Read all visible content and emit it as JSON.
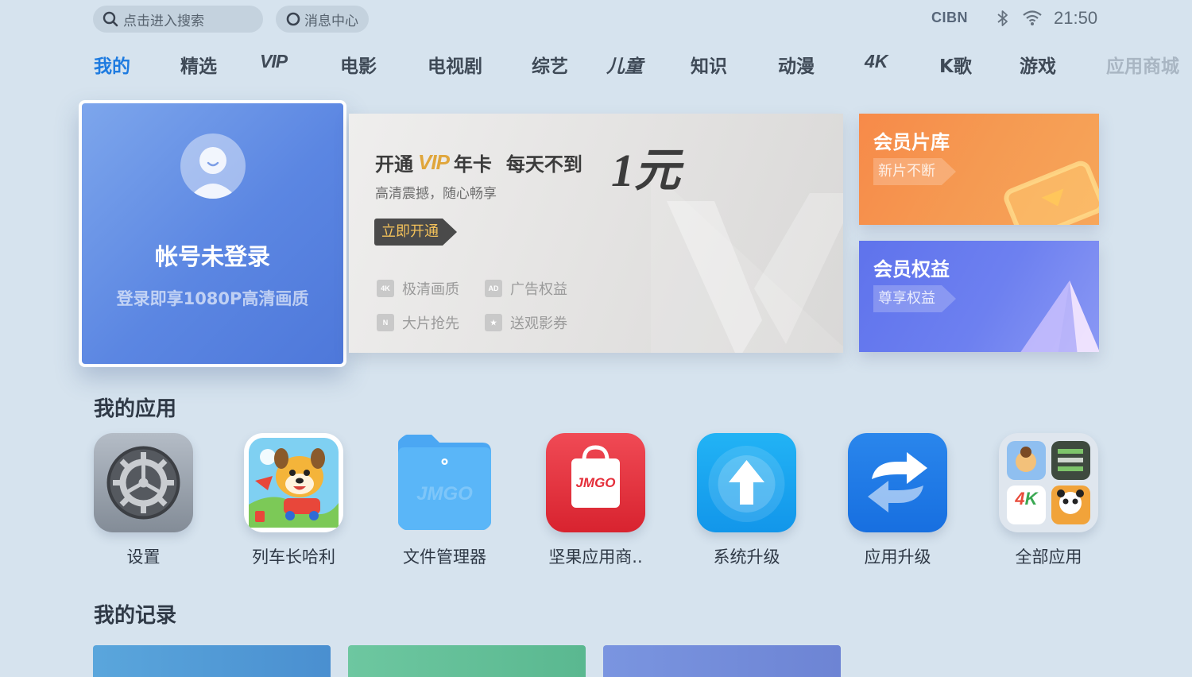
{
  "topbar": {
    "search_label": "点击进入搜索",
    "message_label": "消息中心",
    "cibn_logo": "CIBN",
    "bluetooth_icon": "bluetooth-icon",
    "wifi_icon": "wifi-icon",
    "time": "21:50"
  },
  "nav": {
    "items": [
      {
        "label": "我的",
        "active": true
      },
      {
        "label": "精选"
      },
      {
        "label": "VIP"
      },
      {
        "label": "电影"
      },
      {
        "label": "电视剧"
      },
      {
        "label": "综艺"
      },
      {
        "label": "儿童"
      },
      {
        "label": "知识"
      },
      {
        "label": "动漫"
      },
      {
        "label": "4K"
      },
      {
        "label": "K歌"
      },
      {
        "label": "游戏"
      },
      {
        "label": "应用商城"
      }
    ],
    "accent_color": "#1e7be0"
  },
  "account": {
    "title": "帐号未登录",
    "subtitle": "登录即享1080P高清画质"
  },
  "vip_banner": {
    "title_prefix": "开通",
    "title_vip": "VIP",
    "title_suffix": "年卡",
    "title_tail": "每天不到",
    "price": "1元",
    "subtitle": "高清震撼，随心畅享",
    "cta": "立即开通",
    "features": [
      {
        "icon": "4K",
        "label": "极清画质"
      },
      {
        "icon": "AD",
        "label": "广告权益"
      },
      {
        "icon": "N",
        "label": "大片抢先"
      },
      {
        "icon": "★",
        "label": "送观影券"
      }
    ]
  },
  "promos": [
    {
      "title": "会员片库",
      "tag": "新片不断",
      "color": "#f7864a"
    },
    {
      "title": "会员权益",
      "tag": "尊享权益",
      "color": "#6f7ff0"
    }
  ],
  "sections": {
    "apps_title": "我的应用",
    "records_title": "我的记录"
  },
  "apps": [
    {
      "label": "设置",
      "icon": "settings-gear-icon"
    },
    {
      "label": "列车长哈利",
      "icon": "cartoon-dog-icon"
    },
    {
      "label": "文件管理器",
      "icon": "folder-icon",
      "watermark": "JMGO"
    },
    {
      "label": "坚果应用商..",
      "icon": "shopping-bag-icon",
      "watermark": "JMGO"
    },
    {
      "label": "系统升级",
      "icon": "upload-arrow-icon"
    },
    {
      "label": "应用升级",
      "icon": "refresh-arrows-icon"
    },
    {
      "label": "全部应用",
      "icon": "app-grid-icon"
    }
  ]
}
